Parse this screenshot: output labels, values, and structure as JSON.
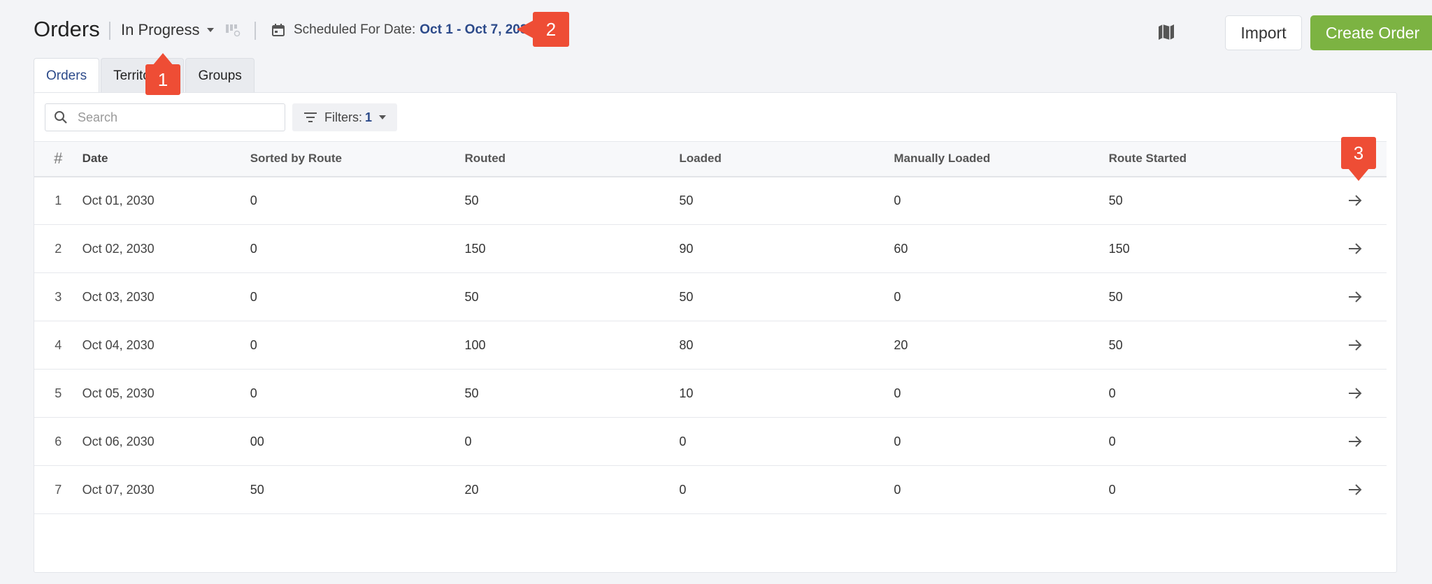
{
  "header": {
    "title": "Orders",
    "status_filter": "In Progress",
    "scheduled_label": "Scheduled For Date:",
    "date_range": "Oct 1 - Oct 7, 2030",
    "import_label": "Import",
    "create_label": "Create Order"
  },
  "tabs": [
    {
      "label": "Orders",
      "active": true
    },
    {
      "label": "Territories",
      "active": false
    },
    {
      "label": "Groups",
      "active": false
    }
  ],
  "search": {
    "placeholder": "Search"
  },
  "filters": {
    "label": "Filters:",
    "count": "1"
  },
  "table": {
    "headers": [
      "#",
      "Date",
      "Sorted by Route",
      "Routed",
      "Loaded",
      "Manually Loaded",
      "Route Started"
    ],
    "rows": [
      [
        "1",
        "Oct 01, 2030",
        "0",
        "50",
        "50",
        "0",
        "50"
      ],
      [
        "2",
        "Oct 02, 2030",
        "0",
        "150",
        "90",
        "60",
        "150"
      ],
      [
        "3",
        "Oct 03, 2030",
        "0",
        "50",
        "50",
        "0",
        "50"
      ],
      [
        "4",
        "Oct 04, 2030",
        "0",
        "100",
        "80",
        "20",
        "50"
      ],
      [
        "5",
        "Oct 05, 2030",
        "0",
        "50",
        "10",
        "0",
        "0"
      ],
      [
        "6",
        "Oct 06, 2030",
        "00",
        "0",
        "0",
        "0",
        "0"
      ],
      [
        "7",
        "Oct 07, 2030",
        "50",
        "20",
        "0",
        "0",
        "0"
      ]
    ]
  },
  "callouts": [
    "1",
    "2",
    "3"
  ],
  "colors": {
    "accent": "#2c4a8a",
    "create_button": "#7cb342",
    "callout": "#ee4d35"
  }
}
